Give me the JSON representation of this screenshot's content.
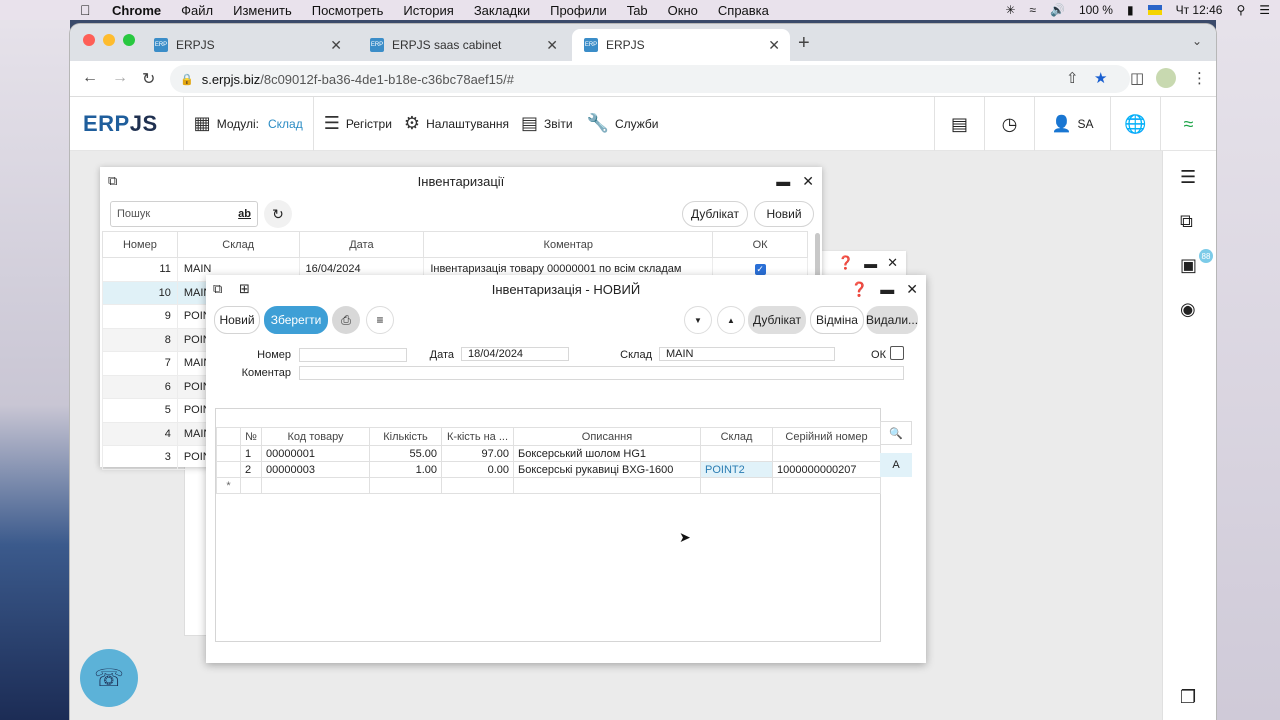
{
  "os_menu": {
    "app": "Chrome",
    "items": [
      "Файл",
      "Изменить",
      "Посмотреть",
      "История",
      "Закладки",
      "Профили",
      "Tab",
      "Окно",
      "Справка"
    ],
    "battery": "100 %",
    "clock": "Чт 12:46"
  },
  "browser": {
    "tabs": [
      {
        "label": "ERPJS"
      },
      {
        "label": "ERPJS saas cabinet"
      },
      {
        "label": "ERPJS"
      }
    ],
    "url_host": "s.erpjs.biz",
    "url_path": "/8c09012f-ba36-4de1-b18e-c36bc78aef15/#"
  },
  "app_header": {
    "logo_erp": "ERP",
    "logo_js": "JS",
    "modules_label": "Модулі:",
    "modules_value": "Склад",
    "registers": "Регістри",
    "settings": "Налаштування",
    "reports": "Звіти",
    "services": "Служби",
    "user": "SA"
  },
  "right_sidebar": {
    "badge": "88"
  },
  "list_window": {
    "title": "Інвентаризації",
    "search_placeholder": "Пошук",
    "search_ab": "ab",
    "btn_duplicate": "Дублікат",
    "btn_new": "Новий",
    "columns": [
      "Номер",
      "Склад",
      "Дата",
      "Коментар",
      "ОК"
    ],
    "rows": [
      {
        "num": "11",
        "warehouse": "MAIN",
        "date": "16/04/2024",
        "comment": "Інвентаризація товару 00000001 по всім складам",
        "ok": true
      },
      {
        "num": "10",
        "warehouse": "MAIN",
        "date": "",
        "comment": "",
        "ok": false
      },
      {
        "num": "9",
        "warehouse": "POIN",
        "date": "",
        "comment": "",
        "ok": false
      },
      {
        "num": "8",
        "warehouse": "POIN",
        "date": "",
        "comment": "",
        "ok": false
      },
      {
        "num": "7",
        "warehouse": "MAIN",
        "date": "",
        "comment": "",
        "ok": false
      },
      {
        "num": "6",
        "warehouse": "POIN",
        "date": "",
        "comment": "",
        "ok": false
      },
      {
        "num": "5",
        "warehouse": "POIN",
        "date": "",
        "comment": "",
        "ok": false
      },
      {
        "num": "4",
        "warehouse": "MAIN",
        "date": "",
        "comment": "",
        "ok": false
      },
      {
        "num": "3",
        "warehouse": "POIN",
        "date": "",
        "comment": "",
        "ok": false
      }
    ]
  },
  "form_window": {
    "title": "Інвентаризація - НОВИЙ",
    "btn_new": "Новий",
    "btn_save": "Зберегти",
    "btn_duplicate": "Дублікат",
    "btn_cancel": "Відміна",
    "btn_delete": "Видали...",
    "fields": {
      "number_label": "Номер",
      "number_value": "",
      "date_label": "Дата",
      "date_value": "18/04/2024",
      "warehouse_label": "Склад",
      "warehouse_value": "MAIN",
      "ok_label": "ОК",
      "comment_label": "Коментар",
      "comment_value": ""
    },
    "detail_columns": [
      "№",
      "Код товару",
      "Кількість",
      "К-кість на ...",
      "Описання",
      "Склад",
      "Серійний номер"
    ],
    "detail_rows": [
      {
        "n": "1",
        "code": "00000001",
        "qty": "55.00",
        "qty_on": "97.00",
        "desc": "Боксерський шолом HG1",
        "wh": "",
        "serial": ""
      },
      {
        "n": "2",
        "code": "00000003",
        "qty": "1.00",
        "qty_on": "0.00",
        "desc": "Боксерські рукавиці BXG-1600",
        "wh": "POINT2",
        "serial": "1000000000207"
      }
    ],
    "new_row_marker": "*",
    "side_tool_a": "A"
  }
}
